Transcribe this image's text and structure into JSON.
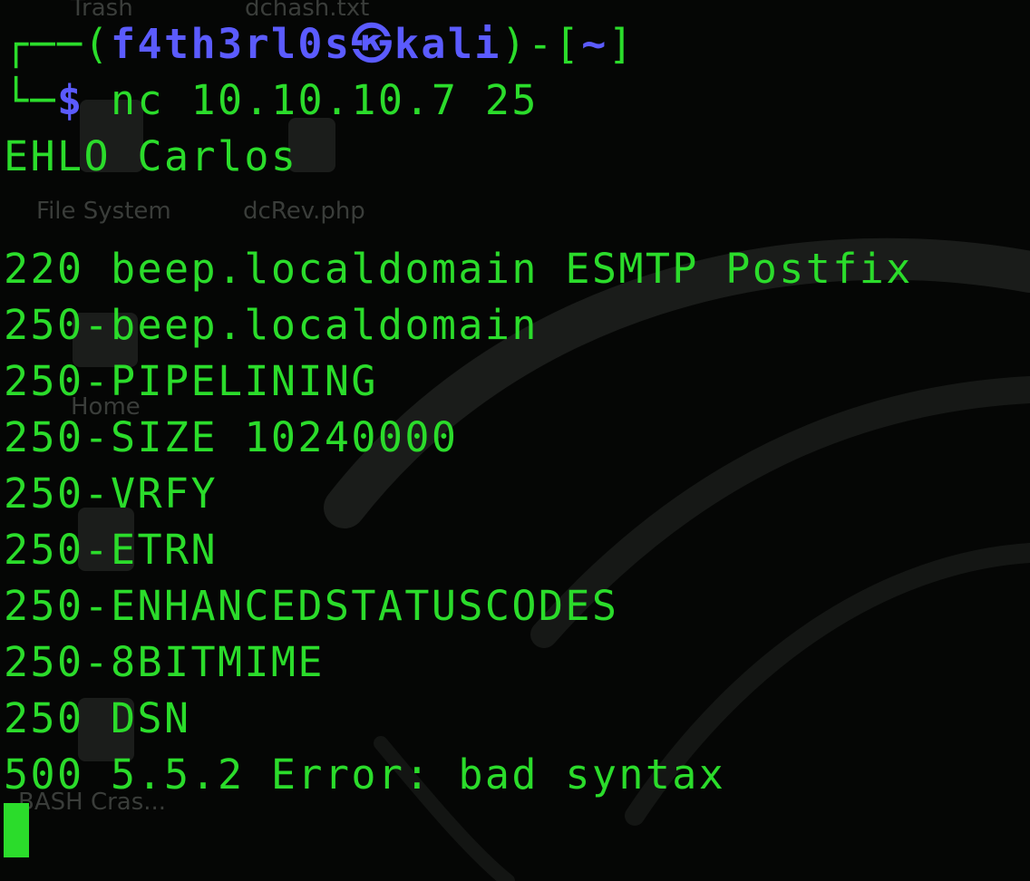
{
  "desktop": {
    "icons": [
      {
        "label": "Trash"
      },
      {
        "label": "dchash.txt"
      },
      {
        "label": "File System"
      },
      {
        "label": "dcRev.php"
      },
      {
        "label": "Home"
      },
      {
        "label": "BASH Cras..."
      }
    ]
  },
  "terminal": {
    "prompt": {
      "frame_open": "┌──(",
      "user": "f4th3rl0s",
      "separator": "㉿",
      "host": "kali",
      "frame_mid": ")-[",
      "cwd": "~",
      "frame_close": "]",
      "line2_frame": "└─",
      "dollar": "$",
      "command": "nc 10.10.10.7 25"
    },
    "lines": [
      "EHLO Carlos",
      "",
      "220 beep.localdomain ESMTP Postfix",
      "250-beep.localdomain",
      "250-PIPELINING",
      "250-SIZE 10240000",
      "250-VRFY",
      "250-ETRN",
      "250-ENHANCEDSTATUSCODES",
      "250-8BITMIME",
      "250 DSN",
      "500 5.5.2 Error: bad syntax"
    ]
  },
  "colors": {
    "text_green": "#2bdc2b",
    "prompt_blue": "#5b5bff",
    "background": "#050605"
  }
}
